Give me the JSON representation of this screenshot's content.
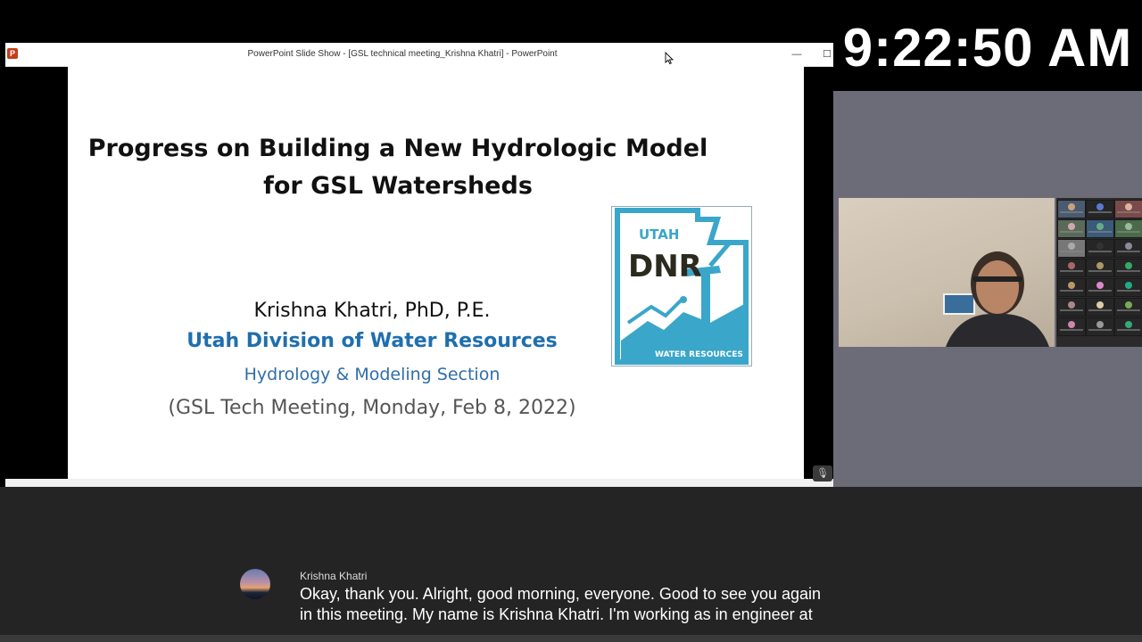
{
  "clock": {
    "time": "9:22:50 AM"
  },
  "window": {
    "title": "PowerPoint Slide Show - [GSL technical meeting_Krishna Khatri] - PowerPoint",
    "app_icon": "powerpoint-icon",
    "minimize_glyph": "—",
    "maximize_glyph": "☐"
  },
  "slide": {
    "title_line1": "Progress on Building a New Hydrologic Model",
    "title_line2": "for GSL Watersheds",
    "author": "Krishna Khatri, PhD, P.E.",
    "organization": "Utah Division of Water Resources",
    "section": "Hydrology & Modeling Section",
    "meeting": "(GSL Tech Meeting, Monday, Feb 8, 2022)",
    "logo": {
      "top_text": "UTAH",
      "main_text": "DNR",
      "bottom_text": "WATER RESOURCES",
      "accent_color": "#3aa6c9"
    }
  },
  "caption": {
    "speaker": "Krishna Khatri",
    "line1": "Okay, thank you. Alright, good morning, everyone. Good to see you again",
    "line2": "in this meeting. My name is Krishna Khatri. I'm working as in engineer at"
  },
  "colors": {
    "side_pane": "#6c6b78",
    "caption_bg": "#242424",
    "org_blue": "#1f6fae"
  }
}
